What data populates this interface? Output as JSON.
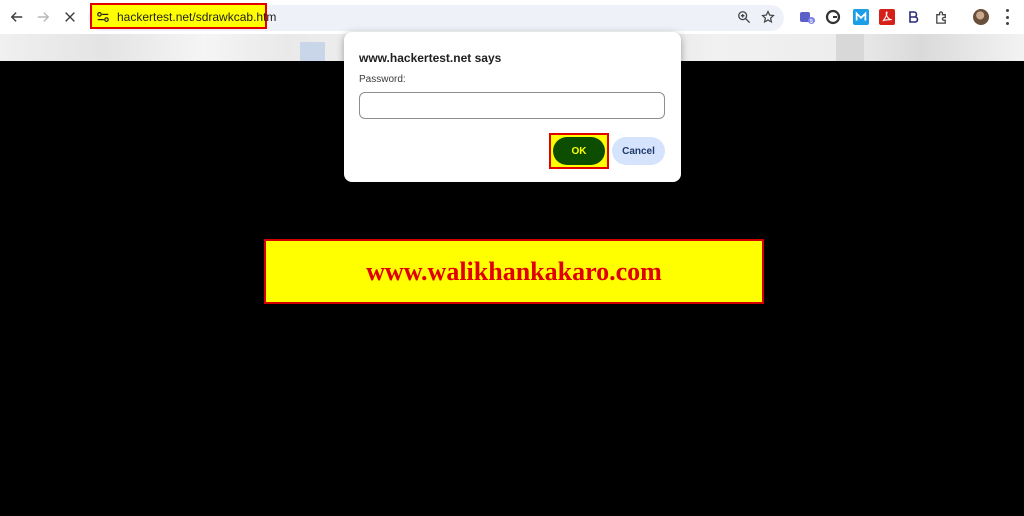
{
  "browser": {
    "url": "hackertest.net/sdrawkcab.htm",
    "icons": {
      "back": "arrow-left-icon",
      "forward": "arrow-right-icon",
      "stop": "close-icon",
      "site_info": "tune-icon",
      "zoom": "zoom-icon",
      "bookmark": "star-icon",
      "extensions": "puzzle-icon",
      "menu": "more-vertical-icon"
    },
    "extensions": [
      "teams",
      "grammarly",
      "m-extension",
      "pdf",
      "b-extension"
    ]
  },
  "page": {
    "banner_text": "www.walikhankakaro.com",
    "background_color": "#000000",
    "banner_bg": "#ffff00",
    "banner_text_color": "#e00000"
  },
  "dialog": {
    "title": "www.hackertest.net says",
    "label": "Password:",
    "input_value": "",
    "ok_label": "OK",
    "cancel_label": "Cancel",
    "ok_color": "#0c4d00",
    "cancel_color": "#d5e3fc"
  },
  "highlight_color": "#ffff00",
  "highlight_border": "#e00000"
}
